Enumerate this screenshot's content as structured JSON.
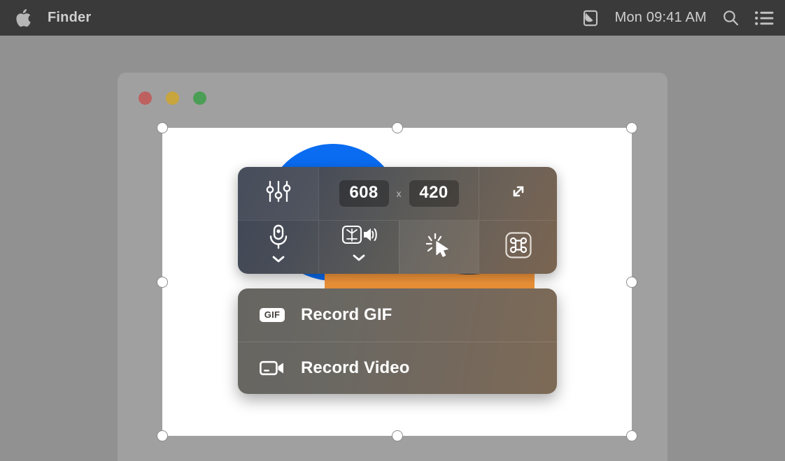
{
  "menubar": {
    "apple_icon": "apple-logo-icon",
    "app_name": "Finder",
    "control_center_icon": "control-center-icon",
    "clock": "Mon 09:41 AM",
    "search_icon": "search-icon",
    "list_icon": "list-icon"
  },
  "window": {
    "close_label": "close",
    "minimize_label": "minimize",
    "zoom_label": "zoom"
  },
  "toolbar": {
    "settings_icon": "sliders-icon",
    "width_value": "608",
    "separator": "x",
    "height_value": "420",
    "expand_icon": "expand-arrows-icon",
    "microphone_icon": "microphone-icon",
    "microphone_chevron": "chevron-down-icon",
    "system_audio_icon": "system-audio-icon",
    "system_audio_chevron": "chevron-down-icon",
    "cursor_icon": "cursor-click-icon",
    "keystrokes_icon": "command-key-icon"
  },
  "dropdown": {
    "items": [
      {
        "icon": "gif-badge-icon",
        "badge_text": "GIF",
        "label": "Record GIF"
      },
      {
        "icon": "video-camera-icon",
        "label": "Record Video"
      }
    ]
  },
  "colors": {
    "desktop": "#919191",
    "menubar": "#3a3a3a",
    "canvas": "#ffffff",
    "accent_blue": "#0a6cf1",
    "accent_orange": "#f99a3c",
    "traffic_red": "#bf6060",
    "traffic_yellow": "#c9a53e",
    "traffic_green": "#4a9e55"
  }
}
